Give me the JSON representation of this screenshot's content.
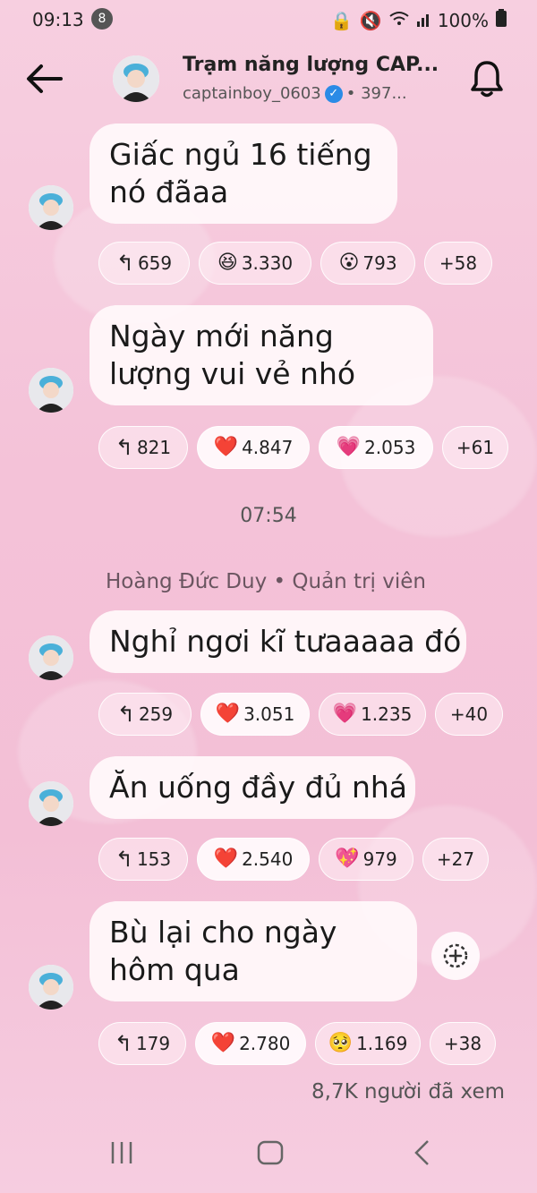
{
  "status": {
    "time": "09:13",
    "notif_count": "8",
    "battery": "100%"
  },
  "header": {
    "title": "Trạm năng lượng CAP...",
    "handle": "captainboy_0603",
    "members": "• 397..."
  },
  "messages": [
    {
      "text": "Giấc ngủ 16 tiếng nó đãaa",
      "reactions": [
        {
          "icon": "reply-icon",
          "glyph": "↰",
          "count": "659"
        },
        {
          "icon": "laughing-emoji",
          "glyph": "😆",
          "count": "3.330"
        },
        {
          "icon": "surprised-emoji",
          "glyph": "😮",
          "count": "793"
        },
        {
          "icon": "",
          "glyph": "",
          "count": "+58"
        }
      ]
    },
    {
      "text": "Ngày mới năng lượng vui vẻ nhó",
      "reactions": [
        {
          "icon": "reply-icon",
          "glyph": "↰",
          "count": "821"
        },
        {
          "icon": "red-heart-emoji",
          "glyph": "❤️",
          "count": "4.847"
        },
        {
          "icon": "sparkling-heart-emoji",
          "glyph": "💗",
          "count": "2.053"
        },
        {
          "icon": "",
          "glyph": "",
          "count": "+61"
        }
      ]
    },
    {
      "text": "Nghỉ ngơi kĩ tưaaaaa đó",
      "reactions": [
        {
          "icon": "reply-icon",
          "glyph": "↰",
          "count": "259"
        },
        {
          "icon": "red-heart-emoji",
          "glyph": "❤️",
          "count": "3.051"
        },
        {
          "icon": "sparkling-heart-emoji",
          "glyph": "💗",
          "count": "1.235"
        },
        {
          "icon": "",
          "glyph": "",
          "count": "+40"
        }
      ]
    },
    {
      "text": "Ăn uống đầy đủ nhá",
      "reactions": [
        {
          "icon": "reply-icon",
          "glyph": "↰",
          "count": "153"
        },
        {
          "icon": "red-heart-emoji",
          "glyph": "❤️",
          "count": "2.540"
        },
        {
          "icon": "heart-with-sparkles-emoji",
          "glyph": "💖",
          "count": "979"
        },
        {
          "icon": "",
          "glyph": "",
          "count": "+27"
        }
      ]
    },
    {
      "text": "Bù lại cho ngày hôm qua",
      "reactions": [
        {
          "icon": "reply-icon",
          "glyph": "↰",
          "count": "179"
        },
        {
          "icon": "red-heart-emoji",
          "glyph": "❤️",
          "count": "2.780"
        },
        {
          "icon": "pleading-face-emoji",
          "glyph": "🥺",
          "count": "1.169"
        },
        {
          "icon": "",
          "glyph": "",
          "count": "+38"
        }
      ]
    }
  ],
  "timestamp": "07:54",
  "sender": "Hoàng Đức Duy • Quản trị viên",
  "views": "8,7K người đã xem",
  "colors": {
    "background": "#f4c2d8",
    "bubble": "#fff8fa",
    "verified": "#2b8be6"
  }
}
